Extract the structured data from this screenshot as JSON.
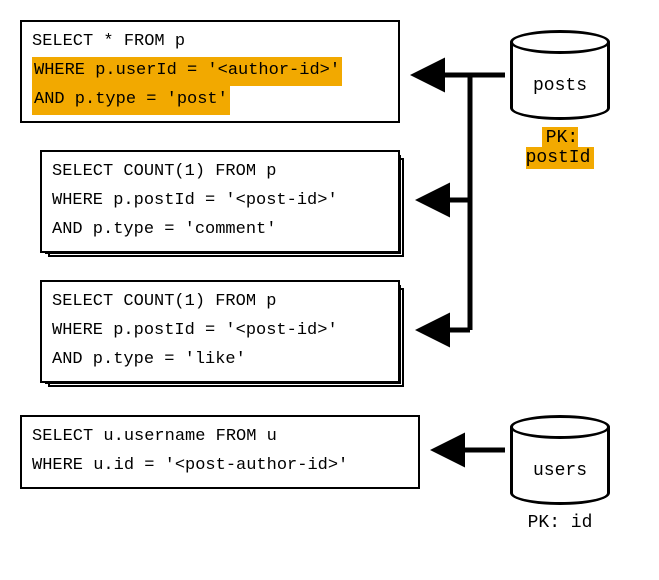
{
  "queries": {
    "q1": {
      "line1": "SELECT * FROM p",
      "line2": "WHERE p.userId = '<author-id>'",
      "line3": "AND p.type = 'post'"
    },
    "q2": {
      "line1": "SELECT COUNT(1) FROM p",
      "line2": "WHERE p.postId = '<post-id>'",
      "line3": "AND p.type = 'comment'"
    },
    "q3": {
      "line1": "SELECT COUNT(1) FROM p",
      "line2": "WHERE p.postId = '<post-id>'",
      "line3": "AND p.type = 'like'"
    },
    "q4": {
      "line1": "SELECT u.username FROM u",
      "line2": "WHERE u.id = '<post-author-id>'"
    }
  },
  "databases": {
    "posts": {
      "label": "posts",
      "pk": "PK: postId"
    },
    "users": {
      "label": "users",
      "pk": "PK: id"
    }
  }
}
